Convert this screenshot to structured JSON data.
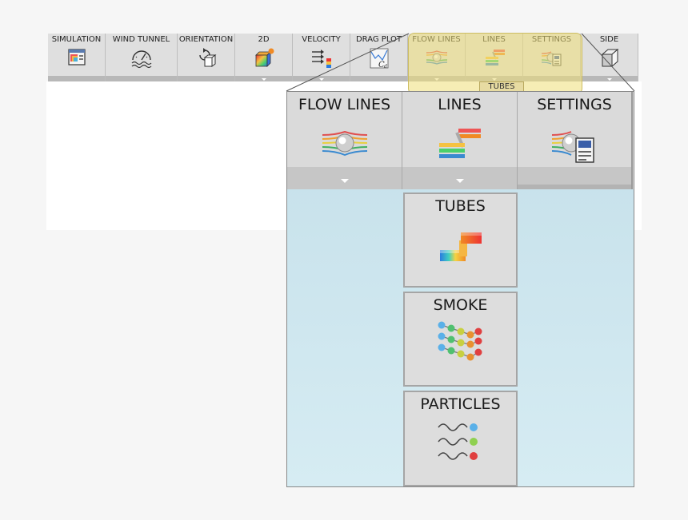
{
  "ribbon": {
    "buttons": [
      {
        "id": "simulation",
        "label": "SIMULATION",
        "icon": "simulation-icon",
        "dropdown": false
      },
      {
        "id": "wind-tunnel",
        "label": "WIND TUNNEL",
        "icon": "wind-tunnel-icon",
        "dropdown": false
      },
      {
        "id": "orientation",
        "label": "ORIENTATION",
        "icon": "orientation-icon",
        "dropdown": false
      },
      {
        "id": "2d",
        "label": "2D",
        "icon": "2d-icon",
        "dropdown": true
      },
      {
        "id": "velocity",
        "label": "VELOCITY",
        "icon": "velocity-icon",
        "dropdown": true
      },
      {
        "id": "drag-plot",
        "label": "DRAG PLOT",
        "icon": "drag-plot-icon",
        "dropdown": false
      },
      {
        "id": "flow-lines",
        "label": "FLOW LINES",
        "icon": "flow-lines-icon",
        "dropdown": true
      },
      {
        "id": "lines",
        "label": "LINES",
        "icon": "lines-icon",
        "dropdown": true
      },
      {
        "id": "settings",
        "label": "SETTINGS",
        "icon": "settings-icon",
        "dropdown": false
      },
      {
        "id": "side",
        "label": "SIDE",
        "icon": "side-cube-icon",
        "dropdown": true
      }
    ],
    "highlighted_label": "TUBES"
  },
  "zoom": {
    "buttons": [
      {
        "id": "flow-lines",
        "label": "FLOW LINES"
      },
      {
        "id": "lines",
        "label": "LINES"
      },
      {
        "id": "settings",
        "label": "SETTINGS"
      }
    ],
    "menu": [
      {
        "id": "tubes",
        "label": "TUBES"
      },
      {
        "id": "smoke",
        "label": "SMOKE"
      },
      {
        "id": "particles",
        "label": "PARTICLES"
      }
    ]
  },
  "colors": {
    "highlight": "#eede78",
    "zoom_bg": "#c4dfe9",
    "button_bg": "#dfdfdf"
  }
}
